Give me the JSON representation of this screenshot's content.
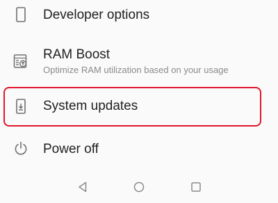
{
  "settings": {
    "items": [
      {
        "title": "Developer options",
        "subtitle": "",
        "icon": "phone-outline-icon"
      },
      {
        "title": "RAM Boost",
        "subtitle": "Optimize RAM utilization based on your usage",
        "icon": "ram-boost-icon"
      },
      {
        "title": "System updates",
        "subtitle": "",
        "icon": "system-update-icon",
        "highlighted": true
      },
      {
        "title": "Power off",
        "subtitle": "",
        "icon": "power-icon"
      }
    ]
  },
  "navbar": {
    "buttons": [
      "back-icon",
      "home-icon",
      "recents-icon"
    ]
  },
  "colors": {
    "highlight": "#e0142b",
    "text_primary": "#1f1f1f",
    "text_secondary": "#8a8a8a",
    "icon": "#6f6f6f"
  }
}
